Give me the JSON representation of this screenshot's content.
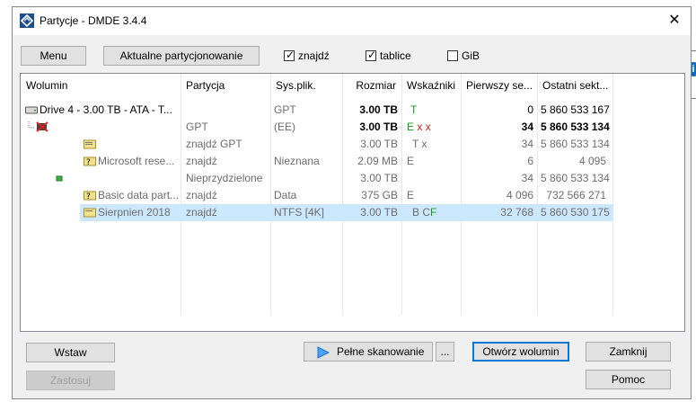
{
  "window": {
    "title": "Partycje - DMDE 3.4.4"
  },
  "toolbar": {
    "menu_label": "Menu",
    "current_partitioning_label": "Aktualne partycjonowanie",
    "checkboxes": [
      {
        "label": "znajdź",
        "checked": true
      },
      {
        "label": "tablice",
        "checked": true
      },
      {
        "label": "GiB",
        "checked": false
      }
    ]
  },
  "table": {
    "headers": [
      "Wolumin",
      "Partycja",
      "Sys.plik.",
      "Rozmiar",
      "Wskaźniki",
      "Pierwszy se...",
      "Ostatni sekt..."
    ],
    "rows": [
      {
        "volume": "Drive 4 - 3.00 TB - ATA - T...",
        "partition": "",
        "fs": "GPT",
        "size": "3.00 TB",
        "flags": "T",
        "first": "0",
        "last": "5 860 533 167"
      },
      {
        "volume": "",
        "partition": "GPT",
        "fs": "(EE)",
        "size": "3.00 TB",
        "flags_a": "E",
        "flags_b": "x x",
        "first": "34",
        "last": "5 860 533 134"
      },
      {
        "volume": "",
        "partition": "znajdź GPT",
        "fs": "",
        "size": "3.00 TB",
        "flags": "T x",
        "first": "34",
        "last": "5 860 533 134"
      },
      {
        "volume": "Microsoft rese...",
        "partition": "znajdź",
        "fs": "Nieznana",
        "size": "2.09 MB",
        "flags": "E",
        "first": "6",
        "last": "4 095"
      },
      {
        "volume": "",
        "partition": "Nieprzydzielone",
        "fs": "",
        "size": "3.00 TB",
        "flags": "",
        "first": "34",
        "last": "5 860 533 134"
      },
      {
        "volume": "Basic data part...",
        "partition": "znajdź",
        "fs": "Data",
        "size": "375 GB",
        "flags": "E",
        "first": "4 096",
        "last": "732 566 271"
      },
      {
        "volume": "Sierpnien 2018",
        "partition": "znajdź",
        "fs": "NTFS [4K]",
        "size": "3.00 TB",
        "flags_a": "B C",
        "flags_b": "F",
        "first": "32 768",
        "last": "5 860 530 175"
      }
    ]
  },
  "buttons": {
    "insert": "Wstaw",
    "apply": "Zastosuj",
    "full_scan": "Pełne skanowanie",
    "ellipsis": "...",
    "open_volume": "Otwórz wolumin",
    "close": "Zamknij",
    "help": "Pomoc"
  },
  "background_hint": {
    "info_glyph": "i"
  }
}
